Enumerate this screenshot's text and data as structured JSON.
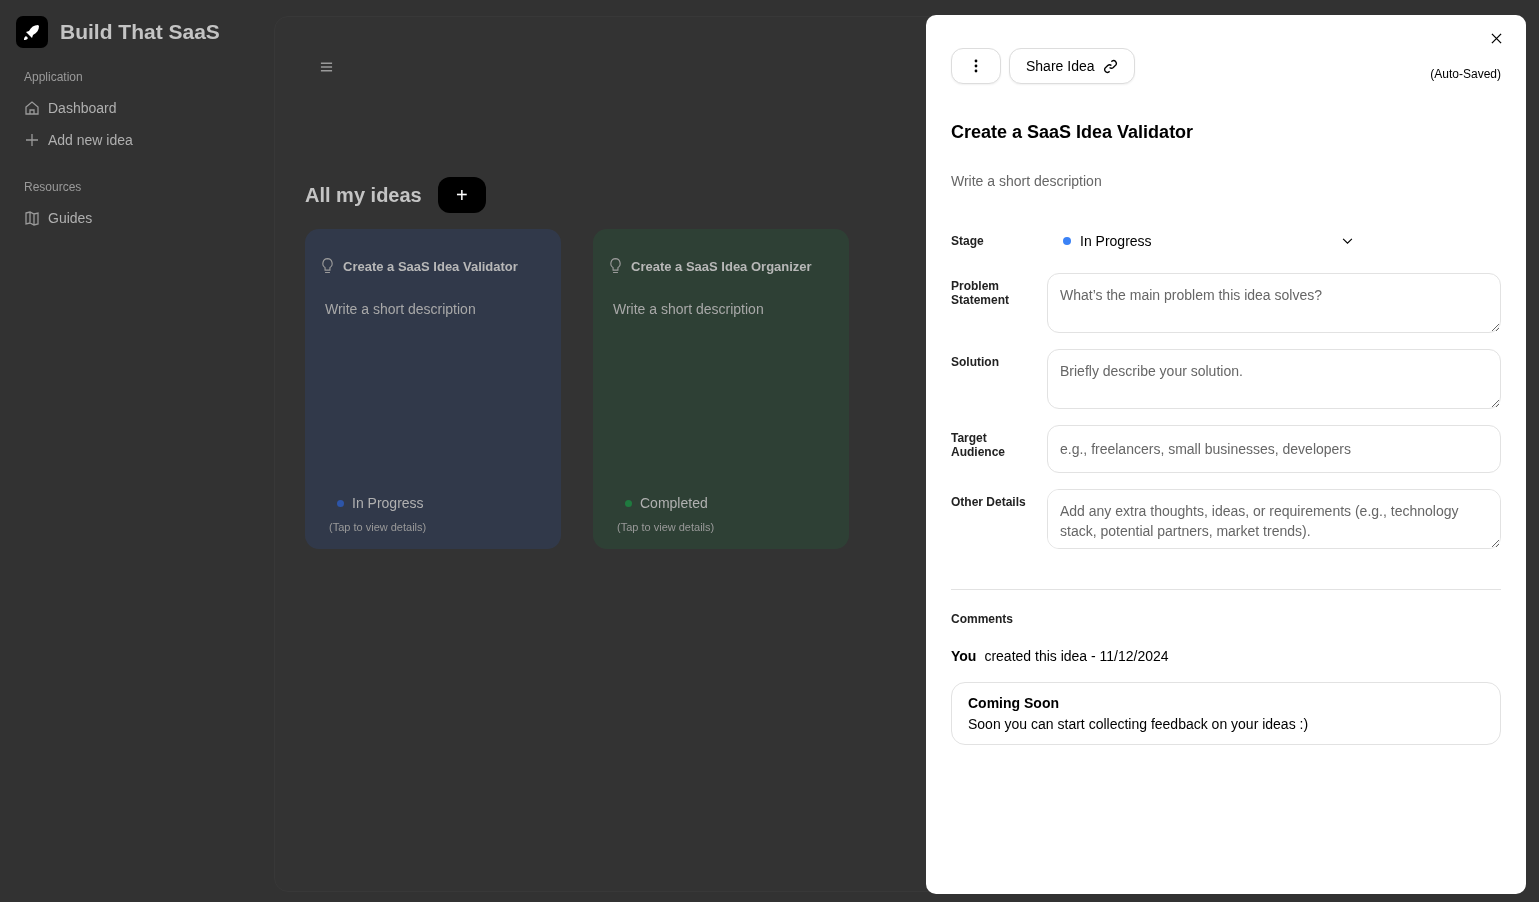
{
  "app": {
    "name": "Build That SaaS"
  },
  "sidebar": {
    "groups": [
      {
        "label": "Application",
        "items": [
          {
            "label": "Dashboard",
            "kind": "home"
          },
          {
            "label": "Add new idea",
            "kind": "add"
          }
        ]
      },
      {
        "label": "Resources",
        "items": [
          {
            "label": "Guides",
            "kind": "guide"
          }
        ]
      }
    ]
  },
  "main": {
    "heading": "All my ideas",
    "add_button": "+",
    "ideas": [
      {
        "title": "Create a SaaS Idea Validator",
        "description": "Write a short description",
        "stage": "In Progress",
        "color": "#2d55a8",
        "hint": "(Tap to view details)"
      },
      {
        "title": "Create a SaaS Idea Organizer",
        "description": "Write a short description",
        "stage": "Completed",
        "color": "#1f7a3f",
        "hint": "(Tap to view details)"
      }
    ]
  },
  "drawer": {
    "share_button": "Share Idea",
    "save_status": "(Auto-Saved)",
    "title": "Create a SaaS Idea Validator",
    "description_placeholder": "Write a short description",
    "stage": {
      "label": "Stage",
      "value": "In Progress",
      "color": "#3b82f6"
    },
    "fields": [
      {
        "label": "Problem Statement",
        "placeholder": "What’s the main problem this idea solves?",
        "kind": "textarea"
      },
      {
        "label": "Solution",
        "placeholder": "Briefly describe your solution.",
        "kind": "textarea"
      },
      {
        "label": "Target Audience",
        "placeholder": "e.g., freelancers, small businesses, developers",
        "kind": "input"
      },
      {
        "label": "Other Details",
        "placeholder": "Add any extra thoughts, ideas, or requirements (e.g., technology stack, potential partners, market trends).",
        "kind": "textarea"
      }
    ],
    "comments": {
      "heading": "Comments",
      "author": "You",
      "activity": "created this idea - 11/12/2024",
      "notice_title": "Coming Soon",
      "notice_text": "Soon you can start collecting feedback on your ideas :)"
    }
  }
}
